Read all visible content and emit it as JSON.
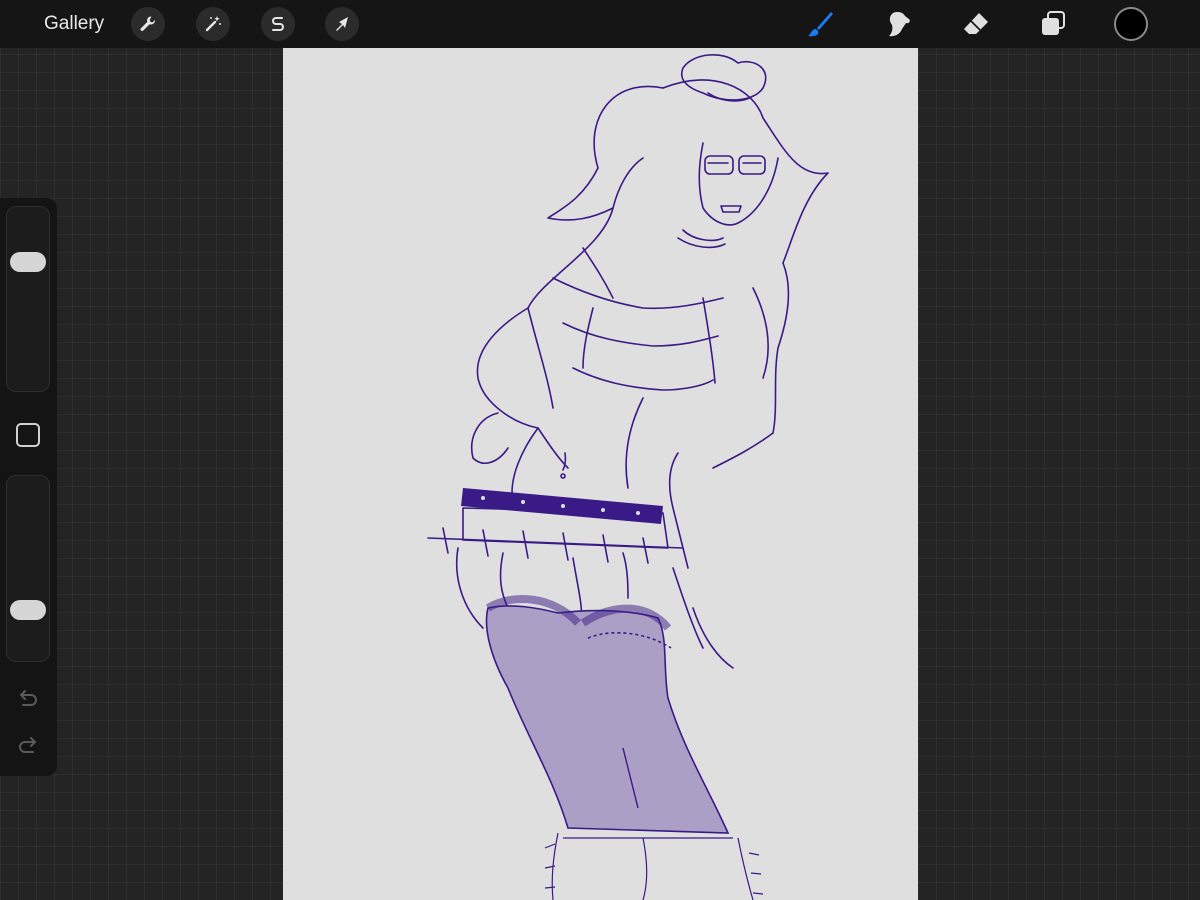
{
  "topbar": {
    "gallery_label": "Gallery",
    "left_tools": [
      {
        "icon": "wrench-icon",
        "name": "actions-button"
      },
      {
        "icon": "magic-wand-icon",
        "name": "adjustments-button"
      },
      {
        "icon": "selection-s-icon",
        "name": "selection-button"
      },
      {
        "icon": "arrow-cursor-icon",
        "name": "transform-button"
      }
    ],
    "right_tools": [
      {
        "icon": "brush-icon",
        "name": "brush-tool",
        "active": true
      },
      {
        "icon": "smudge-icon",
        "name": "smudge-tool",
        "active": false
      },
      {
        "icon": "eraser-icon",
        "name": "eraser-tool",
        "active": false
      },
      {
        "icon": "layers-icon",
        "name": "layers-button",
        "active": false
      }
    ],
    "current_color": "#000000"
  },
  "sidebar": {
    "brush_size_level": 0.82,
    "brush_opacity_level": 0.28,
    "buttons": [
      "modify-button",
      "undo-button",
      "redo-button"
    ]
  },
  "colors": {
    "accent": "#1a7cf5",
    "lineart": "#3a1a86",
    "stocking_fill": "#ab9fc5",
    "canvas": "#dfdfdf"
  }
}
